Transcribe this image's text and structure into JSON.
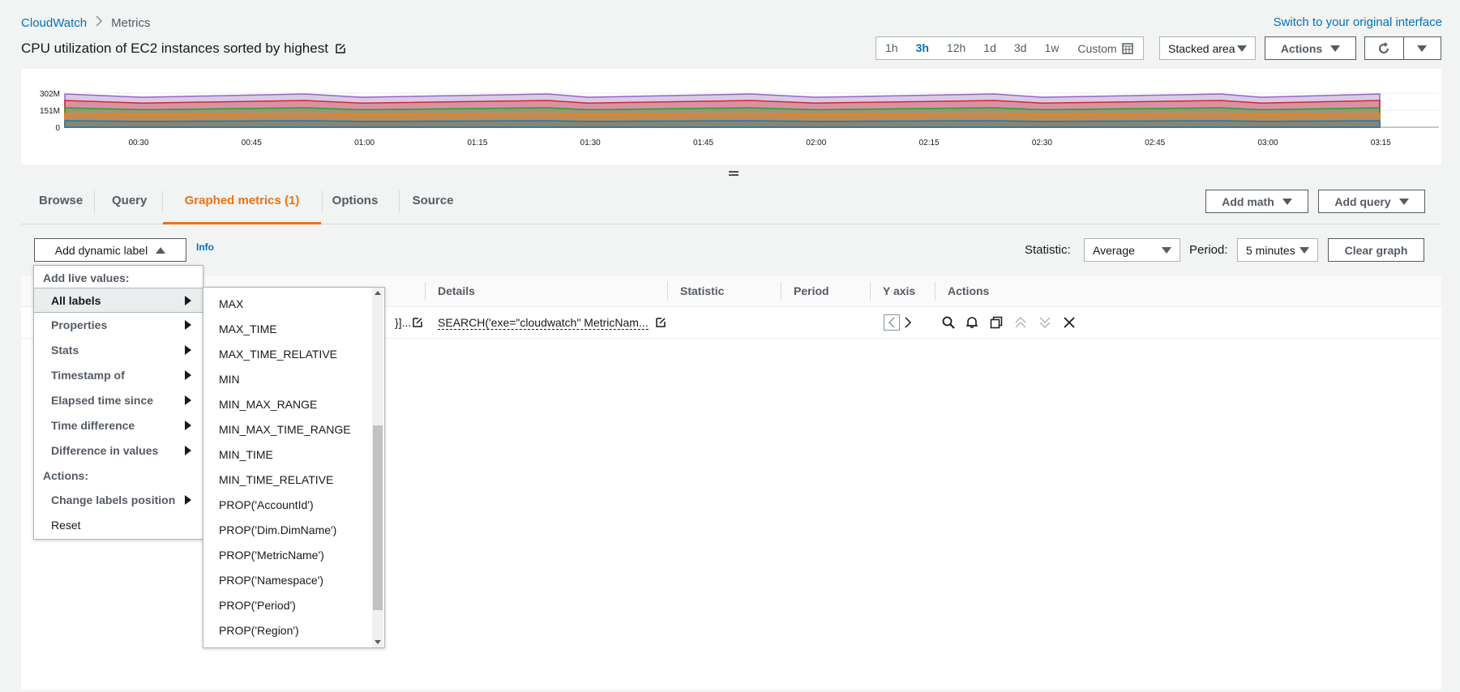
{
  "breadcrumb": {
    "root": "CloudWatch",
    "current": "Metrics"
  },
  "switch_link": "Switch to your original interface",
  "page_title": "CPU utilization of EC2 instances sorted by highest",
  "time_ranges": [
    "1h",
    "3h",
    "12h",
    "1d",
    "3d",
    "1w"
  ],
  "time_selected": "3h",
  "time_custom": "Custom",
  "chart_type_select": "Stacked area",
  "actions_button": "Actions",
  "chart": {
    "y_ticks": [
      "302M",
      "151M",
      "0"
    ],
    "x_ticks": [
      "00:30",
      "00:45",
      "01:00",
      "01:15",
      "01:30",
      "01:45",
      "02:00",
      "02:15",
      "02:30",
      "02:45",
      "03:00",
      "03:15"
    ],
    "colors": [
      "#1f77b4",
      "#ff7f0e",
      "#2ca02c",
      "#d62728",
      "#9467bd"
    ]
  },
  "tabs": [
    {
      "label": "Browse"
    },
    {
      "label": "Query"
    },
    {
      "label": "Graphed metrics (1)"
    },
    {
      "label": "Options"
    },
    {
      "label": "Source"
    }
  ],
  "add_math": "Add math",
  "add_query": "Add query",
  "dynamic_label_button": "Add dynamic label",
  "info_link": "Info",
  "statistic_label": "Statistic:",
  "statistic_value": "Average",
  "period_label": "Period:",
  "period_value": "5 minutes",
  "clear_graph": "Clear graph",
  "table": {
    "headers": {
      "details": "Details",
      "statistic": "Statistic",
      "period": "Period",
      "yaxis": "Y axis",
      "actions": "Actions"
    },
    "row": {
      "label_partial": "}]...",
      "details": "SEARCH('exe=\"cloudwatch\" MetricNam..."
    }
  },
  "menu": {
    "header_live": "Add live values:",
    "items": [
      "All labels",
      "Properties",
      "Stats",
      "Timestamp of",
      "Elapsed time since",
      "Time difference",
      "Difference in values"
    ],
    "header_actions": "Actions:",
    "change_position": "Change labels position",
    "reset": "Reset"
  },
  "submenu": [
    "MAX",
    "MAX_TIME",
    "MAX_TIME_RELATIVE",
    "MIN",
    "MIN_MAX_RANGE",
    "MIN_MAX_TIME_RANGE",
    "MIN_TIME",
    "MIN_TIME_RELATIVE",
    "PROP('AccountId')",
    "PROP('Dim.DimName')",
    "PROP('MetricName')",
    "PROP('Namespace')",
    "PROP('Period')",
    "PROP('Region')"
  ]
}
